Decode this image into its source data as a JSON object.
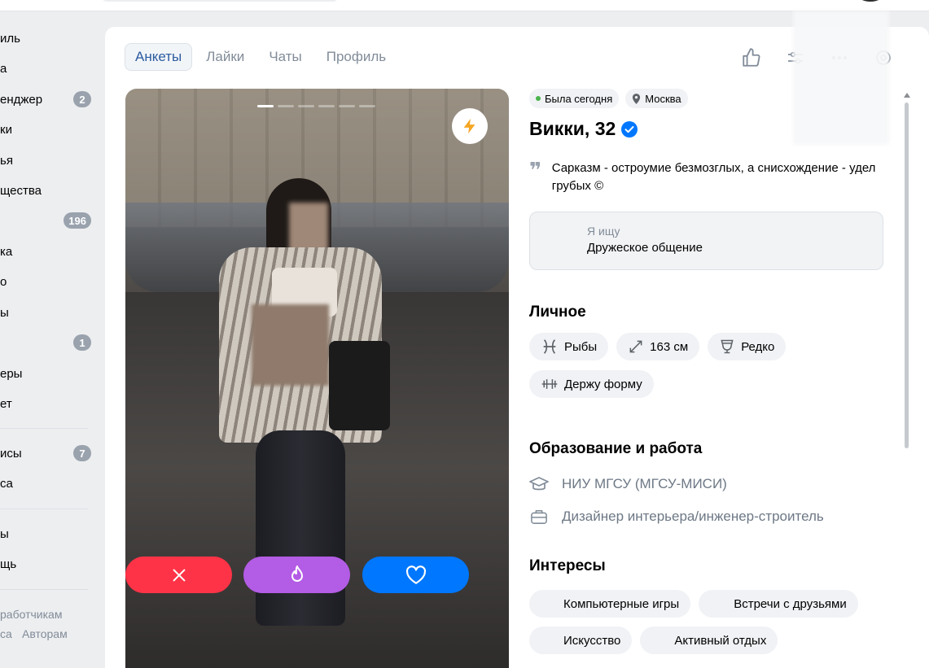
{
  "sidebar": {
    "items": [
      {
        "label": "иль",
        "count": ""
      },
      {
        "label": "а",
        "count": ""
      },
      {
        "label": "енджер",
        "count": "2"
      },
      {
        "label": "ки",
        "count": ""
      },
      {
        "label": "ья",
        "count": ""
      },
      {
        "label": "щества",
        "count": ""
      },
      {
        "label": "",
        "count": "196"
      },
      {
        "label": "ка",
        "count": ""
      },
      {
        "label": "о",
        "count": ""
      },
      {
        "label": "ы",
        "count": ""
      },
      {
        "label": "",
        "count": "1"
      },
      {
        "label": "еры",
        "count": ""
      },
      {
        "label": "ет",
        "count": ""
      },
      {
        "label": "исы",
        "count": "7"
      },
      {
        "label": "са",
        "count": ""
      },
      {
        "label": "ы",
        "count": ""
      },
      {
        "label": "щь",
        "count": ""
      }
    ],
    "footer": {
      "developers": "работчикам",
      "left": "са",
      "authors": "Авторам"
    }
  },
  "tabs": [
    {
      "label": "Анкеты",
      "active": true
    },
    {
      "label": "Лайки",
      "active": false
    },
    {
      "label": "Чаты",
      "active": false
    },
    {
      "label": "Профиль",
      "active": false
    }
  ],
  "top_icons": [
    "thumbs-up-icon",
    "filters-icon",
    "more-icon",
    "settings-icon"
  ],
  "photo": {
    "total_slides": 6,
    "current_slide": 1,
    "boost_icon": "lightning-icon"
  },
  "actions": {
    "dislike_icon": "close-icon",
    "superlike_icon": "fire-icon",
    "like_icon": "heart-icon"
  },
  "profile": {
    "status": "Была сегодня",
    "city": "Москва",
    "name": "Викки, 32",
    "verified": true,
    "quote": "Сарказм - остроумие безмозглых, а снисхождение - удел грубых ©",
    "looking_for_label": "Я ищу",
    "looking_for_value": "Дружеское общение",
    "personal_title": "Личное",
    "personal_tags": [
      {
        "icon": "pisces-icon",
        "label": "Рыбы"
      },
      {
        "icon": "height-icon",
        "label": "163 см"
      },
      {
        "icon": "glass-icon",
        "label": "Редко"
      },
      {
        "icon": "dumbbell-icon",
        "label": "Держу форму"
      }
    ],
    "education_title": "Образование и работа",
    "education": "НИУ МГСУ (МГСУ-МИСИ)",
    "job": "Дизайнер интерьера/инженер-строитель",
    "interests_title": "Интересы",
    "interests": [
      "Компьютерные игры",
      "Встречи с друзьями",
      "Искусство",
      "Активный отдых"
    ]
  },
  "colors": {
    "accent": "#0077ff",
    "dislike": "#ff3347",
    "superlike": "#b35ce5",
    "online": "#4bb34b",
    "boost": "#f5a623"
  }
}
